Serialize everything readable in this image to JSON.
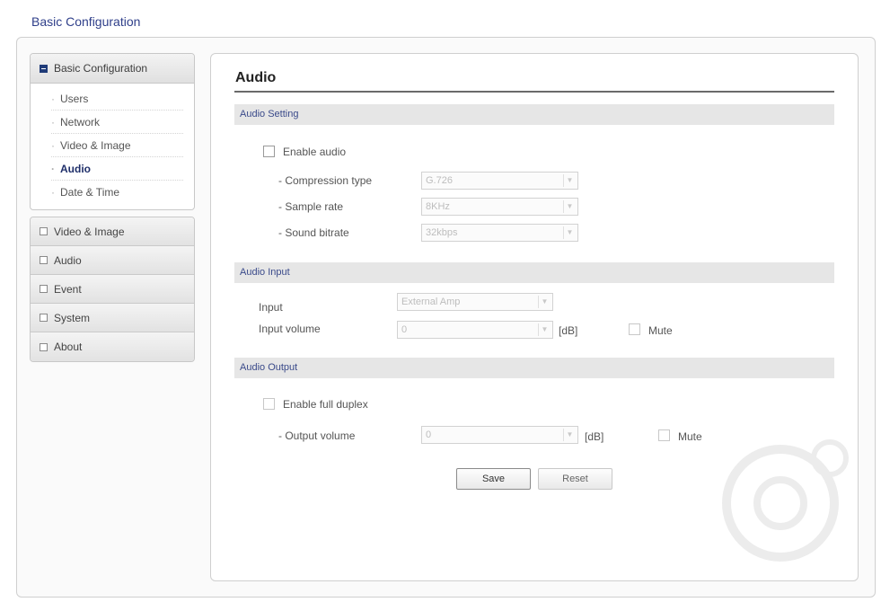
{
  "header": {
    "title": "Basic Configuration"
  },
  "sidebar": {
    "section_title": "Basic Configuration",
    "sub_items": [
      {
        "label": "Users",
        "active": false
      },
      {
        "label": "Network",
        "active": false
      },
      {
        "label": "Video & Image",
        "active": false
      },
      {
        "label": "Audio",
        "active": true
      },
      {
        "label": "Date & Time",
        "active": false
      }
    ],
    "nav_items": [
      {
        "label": "Video & Image"
      },
      {
        "label": "Audio"
      },
      {
        "label": "Event"
      },
      {
        "label": "System"
      },
      {
        "label": "About"
      }
    ]
  },
  "main": {
    "title": "Audio",
    "audio_setting": {
      "heading": "Audio Setting",
      "enable_audio_label": "Enable audio",
      "compression_label": "- Compression type",
      "compression_value": "G.726",
      "sample_rate_label": "- Sample rate",
      "sample_rate_value": "8KHz",
      "bitrate_label": "- Sound bitrate",
      "bitrate_value": "32kbps"
    },
    "audio_input": {
      "heading": "Audio Input",
      "input_label": "Input",
      "input_value": "External Amp",
      "volume_label": "Input volume",
      "volume_value": "0",
      "unit": "[dB]",
      "mute_label": "Mute"
    },
    "audio_output": {
      "heading": "Audio Output",
      "full_duplex_label": "Enable full duplex",
      "volume_label": "- Output volume",
      "volume_value": "0",
      "unit": "[dB]",
      "mute_label": "Mute"
    },
    "buttons": {
      "save": "Save",
      "reset": "Reset"
    }
  }
}
